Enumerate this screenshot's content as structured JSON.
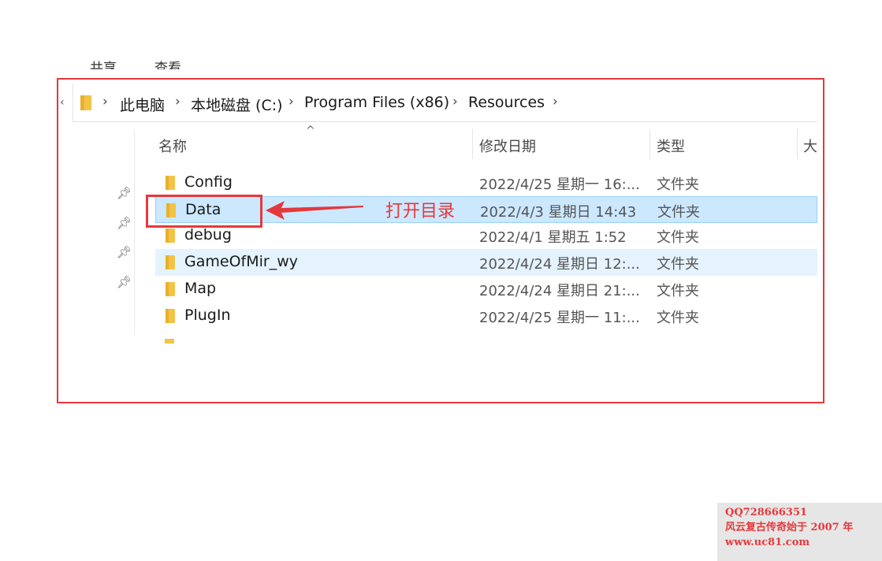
{
  "ribbon": {
    "tabs": [
      "共享",
      "查看"
    ]
  },
  "address": {
    "overflow": "‹",
    "crumbs": [
      "此电脑",
      "本地磁盘 (C:)",
      "Program Files (x86)",
      "Resources"
    ],
    "separator": "›"
  },
  "columns": {
    "name": "名称",
    "date": "修改日期",
    "type": "类型",
    "size": "大"
  },
  "files": [
    {
      "name": "Config",
      "date": "2022/4/25 星期一 16:...",
      "type": "文件夹"
    },
    {
      "name": "Data",
      "date": "2022/4/3 星期日 14:43",
      "type": "文件夹"
    },
    {
      "name": "debug",
      "date": "2022/4/1 星期五 1:52",
      "type": "文件夹"
    },
    {
      "name": "GameOfMir_wy",
      "date": "2022/4/24 星期日 12:...",
      "type": "文件夹"
    },
    {
      "name": "Map",
      "date": "2022/4/24 星期日 21:...",
      "type": "文件夹"
    },
    {
      "name": "PlugIn",
      "date": "2022/4/25 星期一 11:...",
      "type": "文件夹"
    }
  ],
  "annotation": {
    "text": "打开目录",
    "color": "#e4393c"
  },
  "watermark": {
    "qq": "QQ728666351",
    "slogan": "风云复古传奇始于 2007 年",
    "site": "www.uc81.com"
  },
  "colors": {
    "selected_bg": "#cce8ff",
    "hover_bg": "#e5f3ff",
    "folder": "#f3c348",
    "accent_red": "#e4393c"
  },
  "icons": {
    "pin": "pin-icon",
    "folder": "folder-icon",
    "separator": "chevron-right-icon"
  }
}
